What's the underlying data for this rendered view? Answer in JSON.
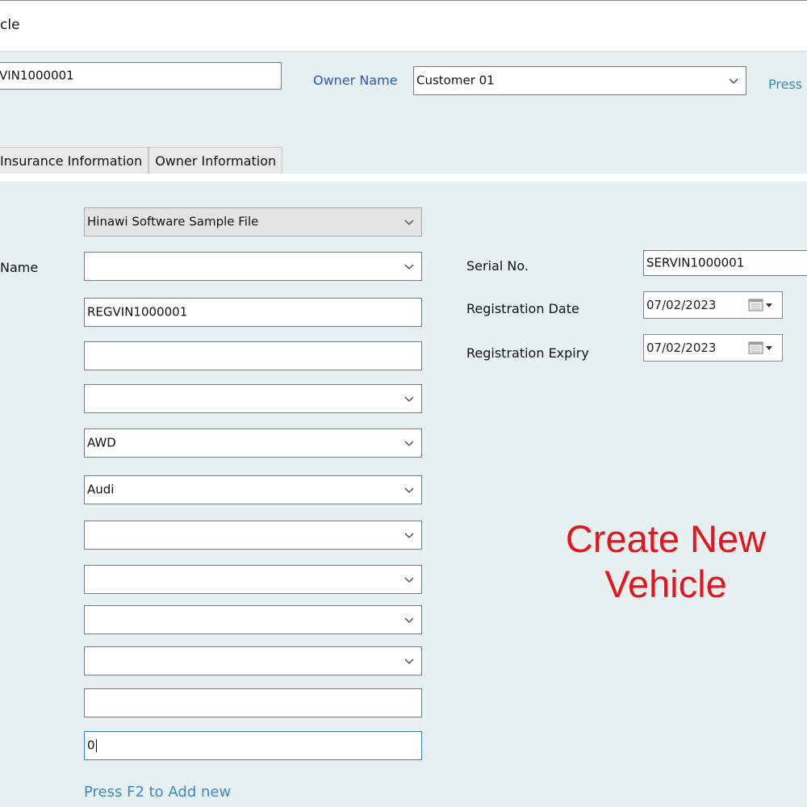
{
  "window": {
    "title": "cle"
  },
  "header": {
    "vin_value": "VIN1000001",
    "owner_label": "Owner Name",
    "owner_value": "Customer 01",
    "press_hint": "Press"
  },
  "tabs": [
    {
      "label": "Insurance Information"
    },
    {
      "label": "Owner Information"
    }
  ],
  "form": {
    "left_labels": {
      "name_label": "Name"
    },
    "company_value": "Hinawi Software Sample File",
    "name_value": "",
    "registration_value": "REGVIN1000001",
    "field4_value": "",
    "field5_value": "",
    "drive_value": "AWD",
    "make_value": "Audi",
    "field8_value": "",
    "field9_value": "",
    "field10_value": "",
    "field11_value": "",
    "field12_value": "",
    "field13_value": "0",
    "add_new_hint": "Press F2 to Add new"
  },
  "right": {
    "serial_label": "Serial No.",
    "serial_value": "SERVIN1000001",
    "reg_date_label": "Registration Date",
    "reg_date_value": "07/02/2023",
    "reg_expiry_label": "Registration Expiry",
    "reg_expiry_value": "07/02/2023"
  },
  "overlay": {
    "line1": "Create New",
    "line2": "Vehicle"
  },
  "colors": {
    "background": "#e6f0f1",
    "label_blue": "#2c58b8",
    "link_blue": "#3f86c9",
    "overlay_red": "#e8141c",
    "focus_border": "#3d7fd1"
  }
}
